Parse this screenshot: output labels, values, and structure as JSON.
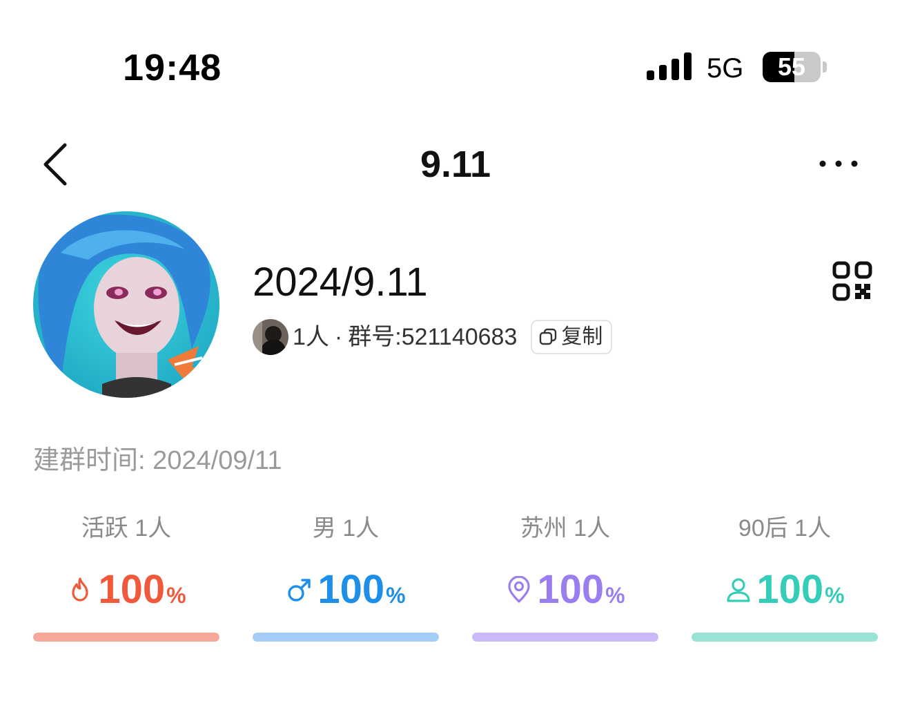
{
  "status_bar": {
    "time": "19:48",
    "network": "5G",
    "battery_text": "55",
    "battery_level": 0.55,
    "signal_bars": 4
  },
  "nav": {
    "title": "9.11",
    "back_icon": "chevron-left-icon",
    "more_icon": "more-dots-icon"
  },
  "group": {
    "name": "2024/9.11",
    "member_count": "1人",
    "separator": "·",
    "group_id_label": "群号: ",
    "group_id": "521140683",
    "copy_label": "复制",
    "qr_icon": "qr-code-icon"
  },
  "create_time": {
    "label": "建群时间: ",
    "value": "2024/09/11"
  },
  "stats": [
    {
      "label": "活跃 1人",
      "value": "100",
      "unit": "%",
      "fraction": 1.0,
      "icon": "flame-icon",
      "color": "#f05a3c",
      "bar_color": "#f7a898"
    },
    {
      "label": "男 1人",
      "value": "100",
      "unit": "%",
      "fraction": 1.0,
      "icon": "male-icon",
      "color": "#1d8fe8",
      "bar_color": "#a3cdf6"
    },
    {
      "label": "苏州 1人",
      "value": "100",
      "unit": "%",
      "fraction": 1.0,
      "icon": "location-pin-icon",
      "color": "#9a7ef0",
      "bar_color": "#cbb9f7"
    },
    {
      "label": "90后 1人",
      "value": "100",
      "unit": "%",
      "fraction": 1.0,
      "icon": "person-icon",
      "color": "#36cdb8",
      "bar_color": "#98e3d6"
    }
  ]
}
